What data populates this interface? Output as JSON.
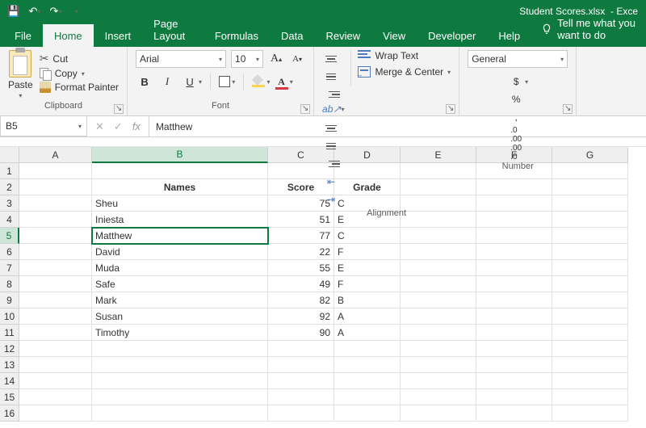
{
  "titlebar": {
    "filename": "Student Scores.xlsx",
    "suffix": "- Exce"
  },
  "qat": {
    "save_tip": "Save",
    "undo_tip": "Undo",
    "redo_tip": "Redo",
    "custom_tip": "Customize"
  },
  "tabs": [
    "File",
    "Home",
    "Insert",
    "Page Layout",
    "Formulas",
    "Data",
    "Review",
    "View",
    "Developer",
    "Help"
  ],
  "active_tab": "Home",
  "tellme": "Tell me what you want to do",
  "ribbon": {
    "clipboard": {
      "paste": "Paste",
      "cut": "Cut",
      "copy": "Copy",
      "painter": "Format Painter",
      "group": "Clipboard"
    },
    "font": {
      "family": "Arial",
      "size": "10",
      "group": "Font"
    },
    "alignment": {
      "wrap": "Wrap Text",
      "merge": "Merge & Center",
      "group": "Alignment"
    },
    "number": {
      "format": "General",
      "currency": "$",
      "percent": "%",
      "comma": ",",
      "inc": ".0←",
      "dec": ".0→",
      "group": "Number"
    }
  },
  "fbar": {
    "ref": "B5",
    "value": "Matthew"
  },
  "columns": [
    "A",
    "B",
    "C",
    "D",
    "E",
    "F",
    "G"
  ],
  "selected_col": "B",
  "selected_row": 5,
  "chart_data": {
    "type": "table",
    "headers": {
      "names": "Names",
      "score": "Score",
      "grade": "Grade"
    },
    "rows": [
      {
        "name": "Sheu",
        "score": 75,
        "grade": "C"
      },
      {
        "name": "Iniesta",
        "score": 51,
        "grade": "E"
      },
      {
        "name": "Matthew",
        "score": 77,
        "grade": "C"
      },
      {
        "name": "David",
        "score": 22,
        "grade": "F"
      },
      {
        "name": "Muda",
        "score": 55,
        "grade": "E"
      },
      {
        "name": "Safe",
        "score": 49,
        "grade": "F"
      },
      {
        "name": "Mark",
        "score": 82,
        "grade": "B"
      },
      {
        "name": "Susan",
        "score": 92,
        "grade": "A"
      },
      {
        "name": "Timothy",
        "score": 90,
        "grade": "A"
      }
    ]
  }
}
